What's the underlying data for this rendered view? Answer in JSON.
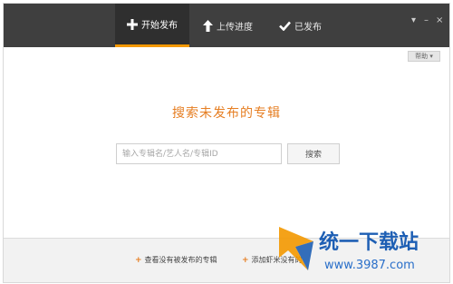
{
  "tabs": [
    {
      "label": "开始发布",
      "icon": "plus-icon",
      "active": true
    },
    {
      "label": "上传进度",
      "icon": "arrow-up-icon",
      "active": false
    },
    {
      "label": "已发布",
      "icon": "check-icon",
      "active": false
    }
  ],
  "window_controls": {
    "menu": "▾",
    "minimize": "–",
    "close": "×"
  },
  "help_label": "帮助 ▾",
  "main": {
    "title": "搜索未发布的专辑",
    "search_placeholder": "输入专辑名/艺人名/专辑ID",
    "search_button": "搜索"
  },
  "footer": {
    "link1": "查看没有被发布的专辑",
    "link2": "添加虾米没有的"
  },
  "watermark": {
    "brand": "统一下载站",
    "url": "www.3987.com"
  },
  "colors": {
    "accent": "#f39800",
    "titlebar": "#3f3f3f",
    "title_text": "#e67e22"
  }
}
